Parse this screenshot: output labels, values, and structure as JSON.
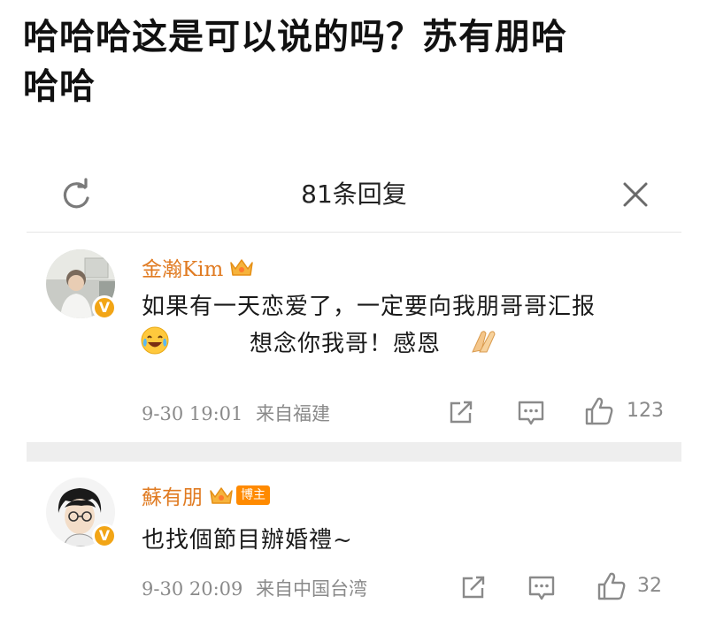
{
  "headline": {
    "line1": "哈哈哈这是可以说的吗？苏有朋哈",
    "line2": "哈哈"
  },
  "panel": {
    "title": "81条回复",
    "refresh_icon": "refresh-icon",
    "close_icon": "close-icon"
  },
  "comments": [
    {
      "username": "金瀚Kim",
      "badge": "crown-icon",
      "verified_icon": "verified-v-icon",
      "text_line1": "如果有一天恋爱了，一定要向我朋哥哥汇报",
      "text_line2": "想念你我哥！感恩",
      "emoji_start": "laugh-cry-emoji",
      "emoji_end": "clasped-hands-emoji",
      "date": "9-30 19:01",
      "source": "来自福建",
      "likes": "123"
    },
    {
      "username": "蘇有朋",
      "badge": "crown-icon",
      "host_tag": "博主",
      "verified_icon": "verified-v-icon",
      "text_line1": "也找個節目辦婚禮~",
      "date": "9-30 20:09",
      "source": "来自中国台湾",
      "likes": "32"
    }
  ],
  "colors": {
    "username": "#e07b22",
    "meta": "#8a8a8a",
    "badge": "#f2a516",
    "divider": "#eeeeee"
  }
}
